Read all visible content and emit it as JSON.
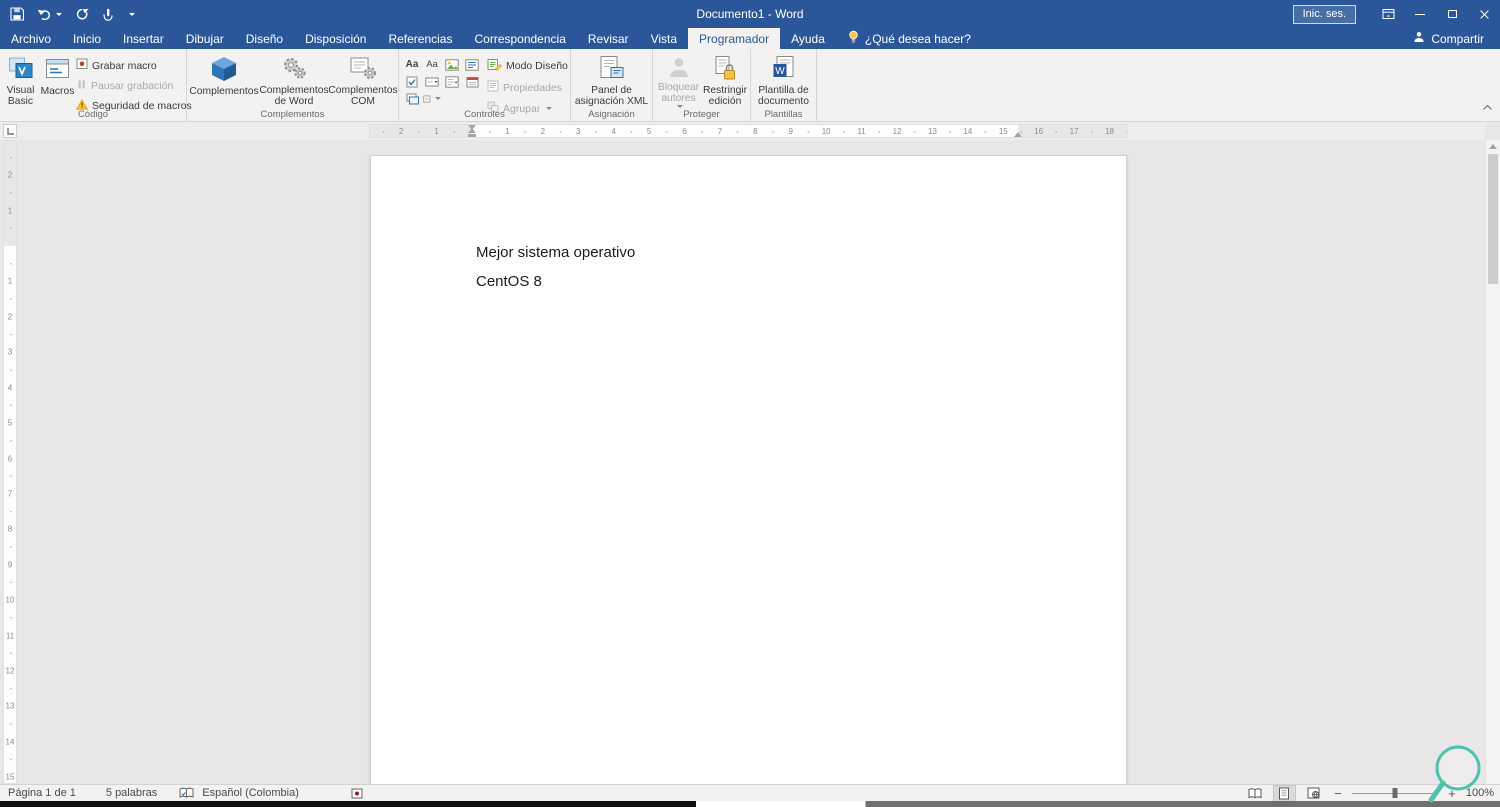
{
  "title_bar": {
    "title": "Documento1 - Word",
    "sign_in_label": "Inic. ses."
  },
  "tabs": [
    {
      "label": "Archivo"
    },
    {
      "label": "Inicio"
    },
    {
      "label": "Insertar"
    },
    {
      "label": "Dibujar"
    },
    {
      "label": "Diseño"
    },
    {
      "label": "Disposición"
    },
    {
      "label": "Referencias"
    },
    {
      "label": "Correspondencia"
    },
    {
      "label": "Revisar"
    },
    {
      "label": "Vista"
    },
    {
      "label": "Programador"
    },
    {
      "label": "Ayuda"
    }
  ],
  "tell_me": "¿Qué desea hacer?",
  "share_label": "Compartir",
  "ribbon": {
    "codigo": {
      "label": "Código",
      "visual_basic": "Visual Basic",
      "macros": "Macros",
      "grabar": "Grabar macro",
      "pausar": "Pausar grabación",
      "seguridad": "Seguridad de macros"
    },
    "complementos": {
      "label": "Complementos",
      "b1": "Complementos",
      "b2": "Complementos de Word",
      "b3": "Complementos COM"
    },
    "controles": {
      "label": "Controles",
      "aa_rich": "Aa",
      "aa_plain": "Aa",
      "modo_diseno": "Modo Diseño",
      "propiedades": "Propiedades",
      "agrupar": "Agrupar"
    },
    "asignacion": {
      "label": "Asignación",
      "panel_xml": "Panel de asignación XML"
    },
    "proteger": {
      "label": "Proteger",
      "bloquear": "Bloquear autores",
      "restringir": "Restringir edición"
    },
    "plantillas": {
      "label": "Plantillas",
      "plantilla": "Plantilla de documento"
    }
  },
  "document": {
    "line1": "Mejor sistema operativo",
    "line2": "CentOS 8"
  },
  "ruler": {
    "h_margin_numbers": [
      1,
      2
    ],
    "h_numbers": [
      1,
      2,
      3,
      4,
      5,
      6,
      7,
      8,
      9,
      10,
      11,
      12,
      13,
      14,
      15,
      16,
      17,
      18
    ],
    "v_margin_numbers": [
      1,
      2
    ],
    "v_numbers": [
      1,
      2,
      3,
      4,
      5,
      6,
      7,
      8,
      9,
      10,
      11,
      12,
      13,
      14,
      15
    ]
  },
  "status_bar": {
    "page": "Página 1 de 1",
    "words": "5 palabras",
    "language": "Español (Colombia)",
    "zoom_out": "−",
    "zoom_in": "+",
    "zoom": "100%"
  }
}
